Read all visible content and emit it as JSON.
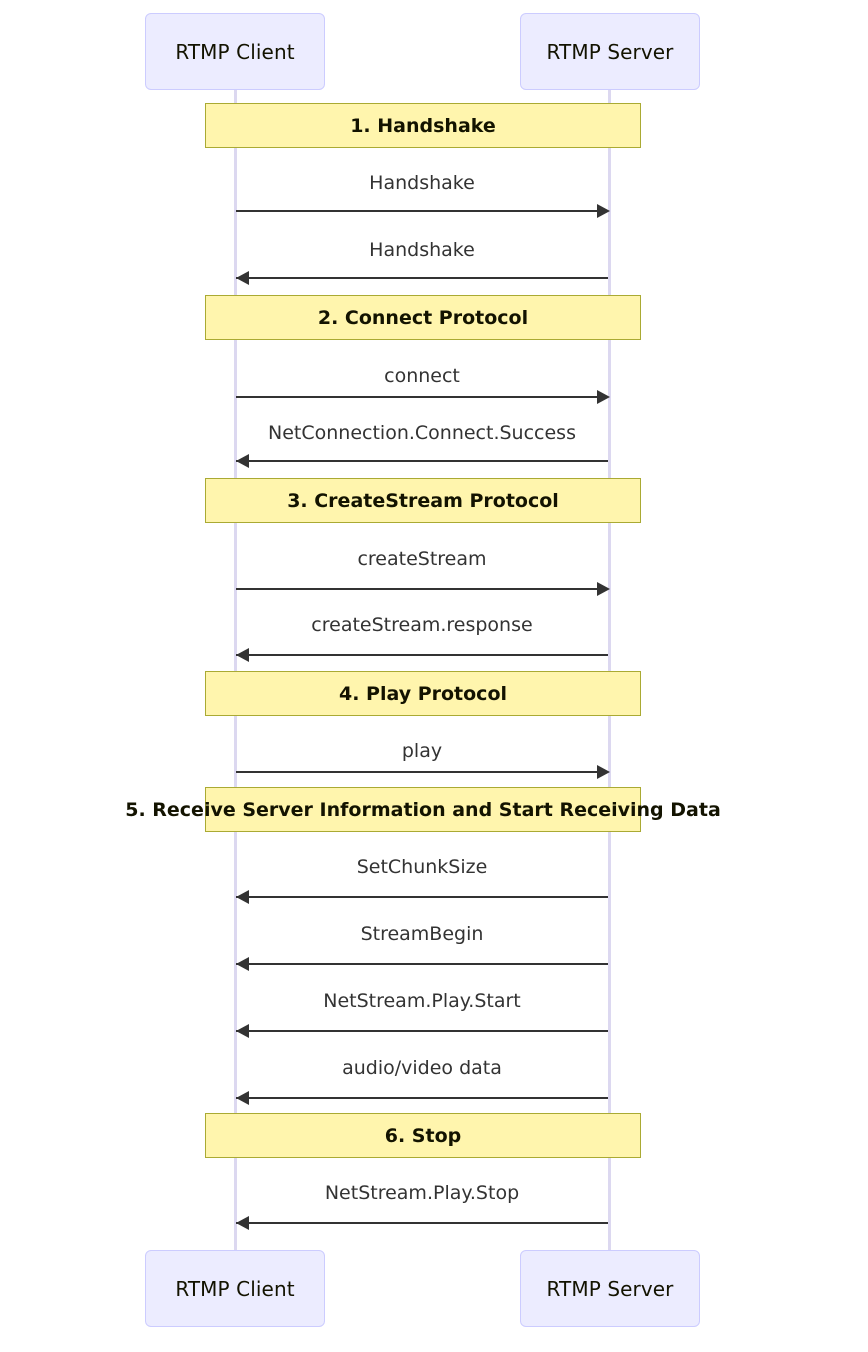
{
  "diagram": {
    "type": "sequence",
    "title": "RTMP Client / RTMP Server message sequence",
    "colors": {
      "actor_fill": "#ECECFF",
      "actor_border": "#CCCCFF",
      "lifeline": "#DCD8F0",
      "note_fill": "#FFF5AD",
      "note_border": "#AAAA33",
      "line": "#333333",
      "text": "#131300",
      "background": "#FFFFFF"
    },
    "actors": [
      {
        "id": "client",
        "label": "RTMP Client"
      },
      {
        "id": "server",
        "label": "RTMP Server"
      }
    ],
    "actors_bottom": [
      {
        "id": "client",
        "label": "RTMP Client"
      },
      {
        "id": "server",
        "label": "RTMP Server"
      }
    ],
    "notes": [
      {
        "id": "note-1",
        "label": "1. Handshake"
      },
      {
        "id": "note-2",
        "label": "2. Connect Protocol"
      },
      {
        "id": "note-3",
        "label": "3. CreateStream Protocol"
      },
      {
        "id": "note-4",
        "label": "4. Play Protocol"
      },
      {
        "id": "note-5",
        "label": "5. Receive Server Information and Start Receiving Data"
      },
      {
        "id": "note-6",
        "label": "6. Stop"
      }
    ],
    "messages": [
      {
        "id": "msg-1",
        "label": "Handshake",
        "from": "client",
        "to": "server",
        "direction": "right"
      },
      {
        "id": "msg-2",
        "label": "Handshake",
        "from": "server",
        "to": "client",
        "direction": "left"
      },
      {
        "id": "msg-3",
        "label": "connect",
        "from": "client",
        "to": "server",
        "direction": "right"
      },
      {
        "id": "msg-4",
        "label": "NetConnection.Connect.Success",
        "from": "server",
        "to": "client",
        "direction": "left"
      },
      {
        "id": "msg-5",
        "label": "createStream",
        "from": "client",
        "to": "server",
        "direction": "right"
      },
      {
        "id": "msg-6",
        "label": "createStream.response",
        "from": "server",
        "to": "client",
        "direction": "left"
      },
      {
        "id": "msg-7",
        "label": "play",
        "from": "client",
        "to": "server",
        "direction": "right"
      },
      {
        "id": "msg-8",
        "label": "SetChunkSize",
        "from": "server",
        "to": "client",
        "direction": "left"
      },
      {
        "id": "msg-9",
        "label": "StreamBegin",
        "from": "server",
        "to": "client",
        "direction": "left"
      },
      {
        "id": "msg-10",
        "label": "NetStream.Play.Start",
        "from": "server",
        "to": "client",
        "direction": "left"
      },
      {
        "id": "msg-11",
        "label": "audio/video data",
        "from": "server",
        "to": "client",
        "direction": "left"
      },
      {
        "id": "msg-12",
        "label": "NetStream.Play.Stop",
        "from": "server",
        "to": "client",
        "direction": "left"
      }
    ]
  }
}
